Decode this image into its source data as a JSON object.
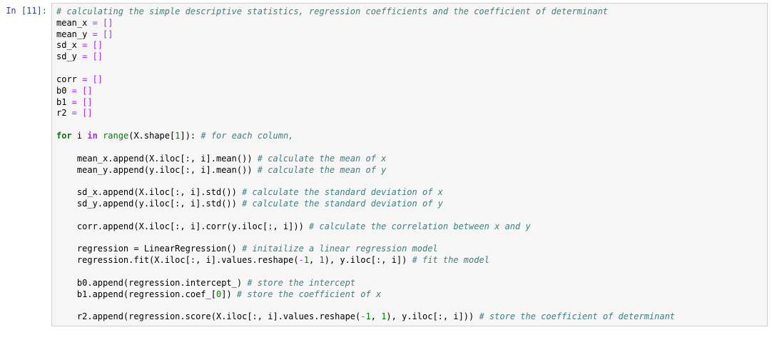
{
  "prompt": {
    "label": "In",
    "number": "11"
  },
  "code": {
    "comment_header": "# calculating the simple descriptive statistics, regression coefficients and the coefficient of determinant",
    "comment_forloop": "# for each column,",
    "comment_mean_x": "# calculate the mean of x",
    "comment_mean_y": "# calculate the mean of y",
    "comment_sd_x": "# calculate the standard deviation of x",
    "comment_sd_y": "# calculate the standard deviation of y",
    "comment_corr": "# calculate the correlation between x and y",
    "comment_reginit": "# initailize a linear regression model",
    "comment_regfit": "# fit the model",
    "comment_b0": "# store the intercept",
    "comment_b1": "# store the coefficient of x",
    "comment_r2": "# store the coefficient of determinant",
    "var_mean_x": "mean_x",
    "var_mean_y": "mean_y",
    "var_sd_x": "sd_x",
    "var_sd_y": "sd_y",
    "var_corr": "corr",
    "var_b0": "b0",
    "var_b1": "b1",
    "var_r2": "r2",
    "var_i": "i",
    "var_regression": "regression",
    "kw_for": "for",
    "kw_in": "in",
    "fn_range": "range",
    "cls_LinearRegression": "LinearRegression",
    "assign_empty": " = []",
    "expr_shape": "X.shape[",
    "num_1": "1",
    "num_neg1": "-1",
    "num_0": "0",
    "stmt_mean_x": "mean_x.append(X.iloc[:, i].mean())",
    "stmt_mean_y": "mean_y.append(y.iloc[:, i].mean())",
    "stmt_sd_x": "sd_x.append(X.iloc[:, i].std())",
    "stmt_sd_y": "sd_y.append(y.iloc[:, i].std())",
    "stmt_corr": "corr.append(X.iloc[:, i].corr(y.iloc[:, i]))",
    "stmt_regnew_pre": "regression = ",
    "stmt_regnew_post": "()",
    "stmt_regfit_a": "regression.fit(X.iloc[:, i].values.reshape(",
    "stmt_regfit_b": ", ",
    "stmt_regfit_c": "), y.iloc[:, i])",
    "stmt_b0": "b0.append(regression.intercept_)",
    "stmt_b1_a": "b1.append(regression.coef_[",
    "stmt_b1_b": "])",
    "stmt_r2_a": "r2.append(regression.score(X.iloc[:, i].values.reshape(",
    "stmt_r2_b": ", ",
    "stmt_r2_c": "), y.iloc[:, i]))"
  }
}
